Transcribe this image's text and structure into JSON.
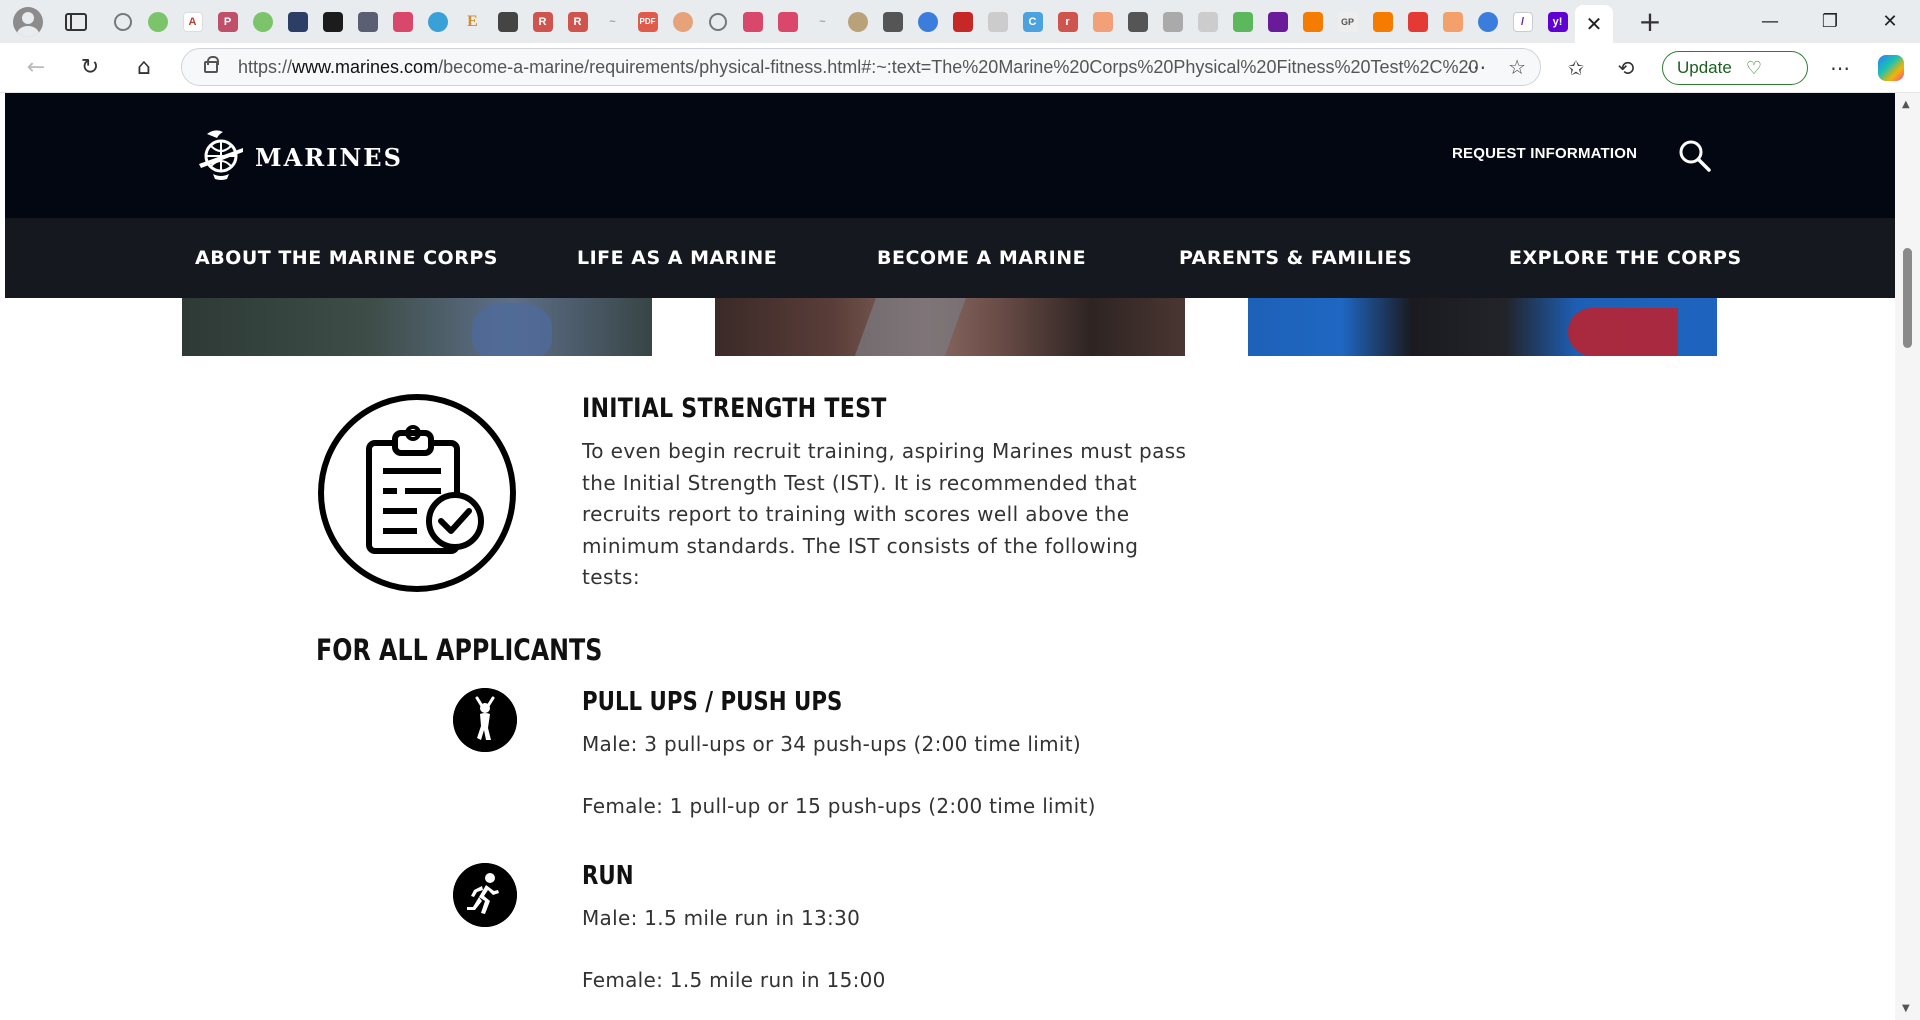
{
  "browser": {
    "tab_close_icon": "close-icon",
    "new_tab_icon": "plus-icon",
    "url_domain": "www.marines.com",
    "url_prefix": "https://",
    "url_rest": "/become-a-marine/requirements/physical-fitness.html#:~:text=The%20Marine%20Corps%20Physical%20Fitness%20Test%2C%20or...",
    "update_label": "Update"
  },
  "site": {
    "logo_text": "MARINES",
    "request_info": "REQUEST INFORMATION",
    "nav": [
      {
        "label": "ABOUT THE MARINE CORPS"
      },
      {
        "label": "LIFE AS A MARINE"
      },
      {
        "label": "BECOME A MARINE"
      },
      {
        "label": "PARENTS & FAMILIES"
      },
      {
        "label": "EXPLORE THE CORPS"
      }
    ]
  },
  "content": {
    "ist_title": "INITIAL STRENGTH TEST",
    "ist_body": "To even begin recruit training, aspiring Marines must pass the Initial Strength Test (IST). It is recommended that recruits report to training with scores well above the minimum standards. The IST consists of the following tests:",
    "all_applicants": "FOR ALL APPLICANTS",
    "pull": {
      "title": "PULL UPS / PUSH UPS",
      "male": "Male: 3 pull-ups or 34 push-ups (2:00 time limit)",
      "female": "Female: 1 pull-up or 15 push-ups (2:00 time limit)"
    },
    "run": {
      "title": "RUN",
      "male": "Male: 1.5 mile run in 13:30",
      "female": "Female: 1.5 mile run in 15:00"
    }
  }
}
